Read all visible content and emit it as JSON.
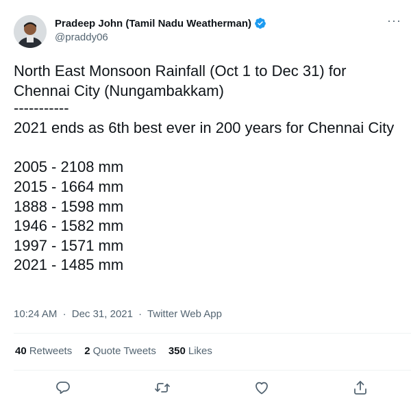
{
  "user": {
    "display_name": "Pradeep John (Tamil Nadu Weatherman)",
    "handle": "@praddy06",
    "verified_icon": "verified-badge-icon"
  },
  "more_label": "···",
  "tweet": {
    "line1": "North East Monsoon Rainfall (Oct 1 to Dec 31) for Chennai City (Nungambakkam)",
    "separator": "-----------",
    "line2": "2021 ends as 6th best ever in 200 years for Chennai City",
    "records": [
      "2005 - 2108 mm",
      "2015 - 1664 mm",
      "1888 - 1598 mm",
      "1946 - 1582 mm",
      "1997 - 1571 mm",
      "2021 - 1485 mm"
    ]
  },
  "meta": {
    "time": "10:24 AM",
    "sep": "·",
    "date": "Dec 31, 2021",
    "source": "Twitter Web App"
  },
  "stats": {
    "retweets_count": "40",
    "retweets_label": "Retweets",
    "quotes_count": "2",
    "quotes_label": "Quote Tweets",
    "likes_count": "350",
    "likes_label": "Likes"
  },
  "colors": {
    "text": "#0f1419",
    "secondary": "#536471",
    "verified": "#1d9bf0",
    "divider": "#eff3f4"
  }
}
